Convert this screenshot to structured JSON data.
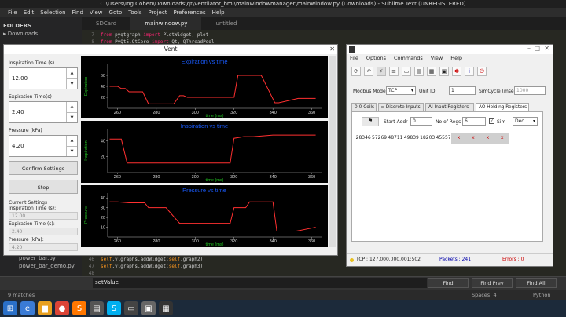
{
  "sublime": {
    "title": "C:\\Users\\Ing Cohen\\Downloads\\qt\\ventilator_hmi\\mainwindowmanager\\mainwindow.py (Downloads) - Sublime Text (UNREGISTERED)",
    "menu": [
      "File",
      "Edit",
      "Selection",
      "Find",
      "View",
      "Goto",
      "Tools",
      "Project",
      "Preferences",
      "Help"
    ],
    "folders_label": "FOLDERS",
    "folders": [
      "Downloads",
      "power_bar.py",
      "power_bar_demo.py"
    ],
    "tabs": [
      "SDCard",
      "mainwindow.py",
      "untitled"
    ],
    "code_top": [
      {
        "n": "7",
        "a": "from ",
        "b": "pyqtgraph ",
        "c": "import ",
        "d": "PlotWidget, plot"
      },
      {
        "n": "8",
        "a": "from ",
        "b": "PyQt5.QtCore ",
        "c": "import ",
        "d": "Qt, QThreadPool"
      }
    ],
    "code_bottom": [
      {
        "n": "46",
        "a": "self",
        "b": ".vlgraphs.addWidget(",
        "c": "self",
        "d": ".graph2)"
      },
      {
        "n": "47",
        "a": "self",
        "b": ".vlgraphs.addWidget(",
        "c": "self",
        "d": ".graph3)"
      },
      {
        "n": "48",
        "a": "",
        "b": "",
        "c": "",
        "d": ""
      }
    ],
    "find_value": "setValue",
    "find_buttons": [
      "Find",
      "Find Prev",
      "Find All"
    ],
    "status_left": "9 matches",
    "status_mid": "Spaces: 4",
    "status_right": "Python"
  },
  "vent": {
    "title": "Vent",
    "insp_label": "Inspiration Time (s)",
    "insp_value": "12.00",
    "exp_label": "Expiration Time(s)",
    "exp_value": "2.40",
    "press_label": "Pressure (kPa)",
    "press_value": "4.20",
    "confirm_btn": "Confirm Settings",
    "stop_btn": "Stop",
    "current_label": "Current Settings",
    "cur_insp_label": "Inspiration Time (s):",
    "cur_insp": "12.00",
    "cur_exp_label": "Expiration Time (s):",
    "cur_exp": "2.40",
    "cur_press_label": "Pressure (kPa):",
    "cur_press": "4.20"
  },
  "chart_data": [
    {
      "type": "line",
      "title": "Expiration vs time",
      "ylabel": "Expiration",
      "xlabel": "time (ms)",
      "xlim": [
        255,
        365
      ],
      "ylim": [
        0,
        80
      ],
      "xticks": [
        260,
        280,
        300,
        320,
        340,
        360
      ],
      "yticks": [
        20,
        40,
        60
      ],
      "color": "#ff3030",
      "title_color": "#1a5cff",
      "label_color": "#20c020",
      "x": [
        256,
        260,
        262,
        264,
        266,
        273,
        276,
        280,
        282,
        289,
        292,
        294,
        296,
        308,
        312,
        320,
        322,
        324,
        330,
        334,
        341,
        343,
        353,
        357,
        362
      ],
      "y": [
        40,
        40,
        36,
        36,
        30,
        30,
        8,
        8,
        8,
        8,
        23,
        23,
        20,
        20,
        20,
        20,
        60,
        60,
        60,
        60,
        10,
        10,
        18,
        18,
        18
      ]
    },
    {
      "type": "line",
      "title": "Inspiration vs time",
      "ylabel": "Inspiration",
      "xlabel": "time (ms)",
      "xlim": [
        255,
        365
      ],
      "ylim": [
        0,
        55
      ],
      "xticks": [
        260,
        280,
        300,
        320,
        340,
        360
      ],
      "yticks": [
        20,
        40
      ],
      "color": "#ff3030",
      "title_color": "#1a5cff",
      "label_color": "#20c020",
      "x": [
        256,
        262,
        265,
        280,
        282,
        284,
        298,
        300,
        302,
        318,
        320,
        325,
        330,
        340,
        350,
        362
      ],
      "y": [
        42,
        42,
        12,
        12,
        12,
        12,
        12,
        12,
        12,
        12,
        43,
        45,
        45,
        47,
        47,
        47
      ]
    },
    {
      "type": "line",
      "title": "Pressure vs time",
      "ylabel": "Pressure",
      "xlabel": "time (ms)",
      "xlim": [
        255,
        365
      ],
      "ylim": [
        0,
        45
      ],
      "xticks": [
        260,
        280,
        300,
        320,
        340,
        360
      ],
      "yticks": [
        10,
        20,
        30,
        40
      ],
      "color": "#ff3030",
      "title_color": "#1a5cff",
      "label_color": "#20c020",
      "x": [
        256,
        260,
        266,
        274,
        276,
        285,
        292,
        298,
        302,
        318,
        320,
        326,
        328,
        340,
        342,
        352,
        362
      ],
      "y": [
        36,
        36,
        35,
        35,
        30,
        30,
        14,
        14,
        14,
        14,
        30,
        30,
        36,
        36,
        6,
        6,
        10
      ]
    }
  ],
  "modbus": {
    "menu": [
      "File",
      "Options",
      "Commands",
      "View",
      "Help"
    ],
    "mode_label": "Modbus Mode",
    "mode_value": "TCP",
    "unit_label": "Unit ID",
    "unit_value": "1",
    "sim_label": "SimCycle (msec)",
    "sim_value": "1000",
    "tabs": [
      "Coils",
      "Discrete Inputs",
      "Input Registers",
      "Holding Registers"
    ],
    "start_label": "Start Addr",
    "start_value": "0",
    "nregs_label": "No of Regs",
    "nregs_value": "6",
    "sim_check": "Sim",
    "format_value": "Dec",
    "registers": [
      "28346",
      "57269",
      "48711",
      "49839",
      "18203",
      "45557"
    ],
    "x_marks": [
      "x",
      "x",
      "x",
      "x"
    ],
    "status_tcp": "TCP : 127.000.000.001:502",
    "status_packets": "Packets : 241",
    "status_errors": "Errors : 0"
  }
}
